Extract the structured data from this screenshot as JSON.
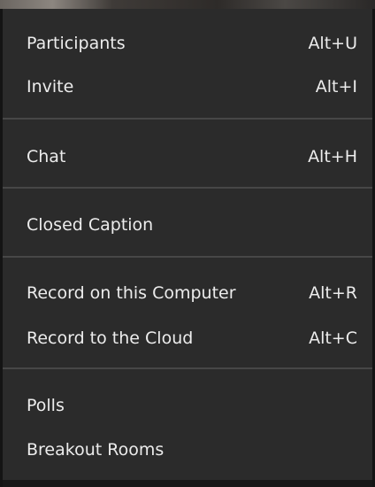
{
  "menu": {
    "items": [
      {
        "label": "Participants",
        "shortcut": "Alt+U"
      },
      {
        "label": "Invite",
        "shortcut": "Alt+I"
      },
      {
        "label": "Chat",
        "shortcut": "Alt+H"
      },
      {
        "label": "Closed Caption",
        "shortcut": ""
      },
      {
        "label": "Record on this Computer",
        "shortcut": "Alt+R"
      },
      {
        "label": "Record to the Cloud",
        "shortcut": "Alt+C"
      },
      {
        "label": "Polls",
        "shortcut": ""
      },
      {
        "label": "Breakout Rooms",
        "shortcut": ""
      }
    ]
  },
  "colors": {
    "menu_background": "#2b2b2b",
    "text": "#ececec",
    "separator": "#474747"
  }
}
